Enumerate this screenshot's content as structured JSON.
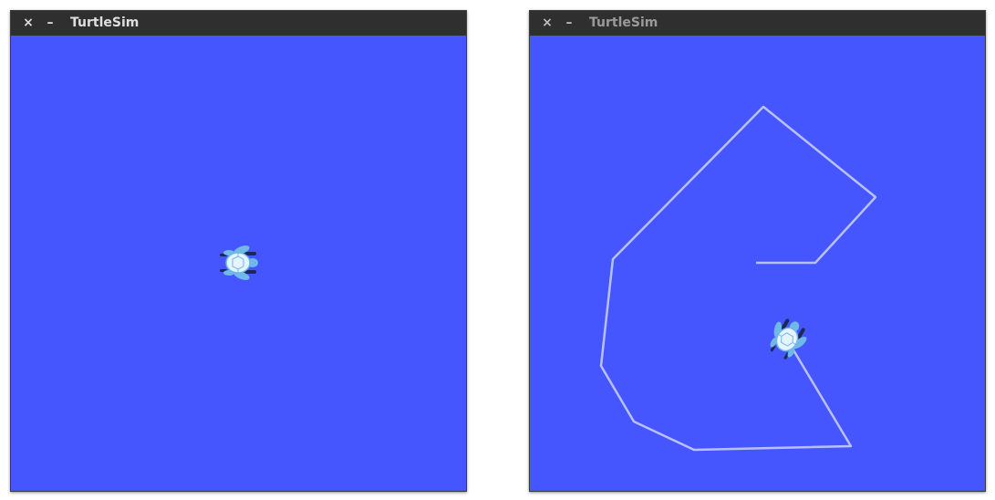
{
  "windows": [
    {
      "title": "TurtleSim",
      "close_glyph": "×",
      "minimize_glyph": "–",
      "icons": {
        "close": "close-icon",
        "minimize": "minimize-icon"
      },
      "state": "focused"
    },
    {
      "title": "TurtleSim",
      "close_glyph": "×",
      "minimize_glyph": "–",
      "icons": {
        "close": "close-icon",
        "minimize": "minimize-icon"
      },
      "state": "unfocused"
    }
  ],
  "colors": {
    "background": "#4556ff",
    "trail": "#b9c0ff",
    "titlebar": "#2f2f2f",
    "turtle_shell": "#e6f4ff",
    "turtle_skin": "#6fb8e8",
    "turtle_dark": "#1a2a55"
  }
}
